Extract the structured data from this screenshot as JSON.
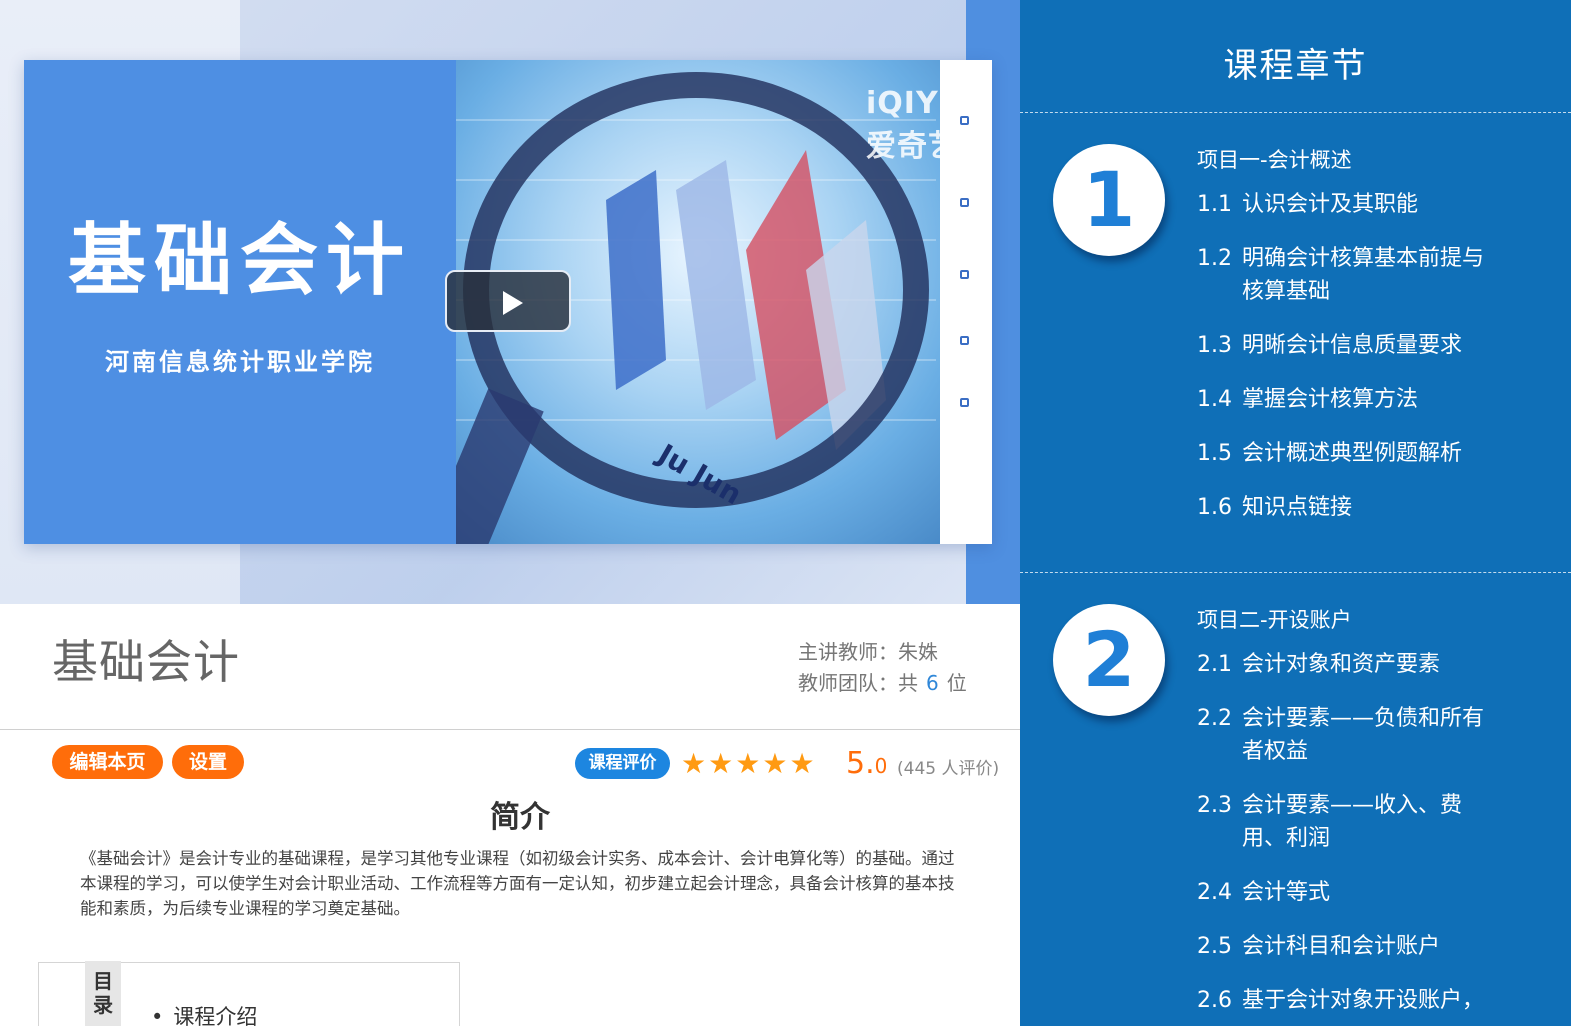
{
  "video": {
    "cover_title": "基础会计",
    "cover_subtitle": "河南信息统计职业学院",
    "watermark": "iQIYI 爱奇艺",
    "chart_text": "Ju Jun"
  },
  "course": {
    "title": "基础会计",
    "teacher_label": "主讲教师：朱姝",
    "team_label_prefix": "教师团队：共",
    "team_count": "6",
    "team_label_suffix": "位"
  },
  "actions": {
    "edit_label": "编辑本页",
    "settings_label": "设置",
    "rating_label": "课程评价",
    "score_main": "5.",
    "score_decimal": "0",
    "rating_count": "(445 人评价)",
    "stars": 5,
    "accent_orange": "#ff6d0a",
    "accent_blue": "#1d86e0"
  },
  "intro": {
    "heading": "简介",
    "text": "《基础会计》是会计专业的基础课程，是学习其他专业课程（如初级会计实务、成本会计、会计电算化等）的基础。通过本课程的学习，可以使学生对会计职业活动、工作流程等方面有一定认知，初步建立起会计理念，具备会计核算的基本技能和素质，为后续专业课程的学习奠定基础。",
    "toc_tab": "目录",
    "toc_first_item": "课程介绍"
  },
  "sidebar": {
    "title": "课程章节",
    "background": "#0f6fb7",
    "projects": [
      {
        "number": "1",
        "title": "项目一-会计概述",
        "chapters": [
          {
            "num": "1.1",
            "title": "认识会计及其职能"
          },
          {
            "num": "1.2",
            "title": "明确会计核算基本前提与核算基础"
          },
          {
            "num": "1.3",
            "title": "明晰会计信息质量要求"
          },
          {
            "num": "1.4",
            "title": "掌握会计核算方法"
          },
          {
            "num": "1.5",
            "title": "会计概述典型例题解析"
          },
          {
            "num": "1.6",
            "title": "知识点链接"
          }
        ]
      },
      {
        "number": "2",
        "title": "项目二-开设账户",
        "chapters": [
          {
            "num": "2.1",
            "title": "会计对象和资产要素"
          },
          {
            "num": "2.2",
            "title": "会计要素——负债和所有者权益"
          },
          {
            "num": "2.3",
            "title": "会计要素——收入、费用、利润"
          },
          {
            "num": "2.4",
            "title": "会计等式"
          },
          {
            "num": "2.5",
            "title": "会计科目和会计账户"
          },
          {
            "num": "2.6",
            "title": "基于会计对象开设账户，"
          }
        ]
      }
    ]
  }
}
